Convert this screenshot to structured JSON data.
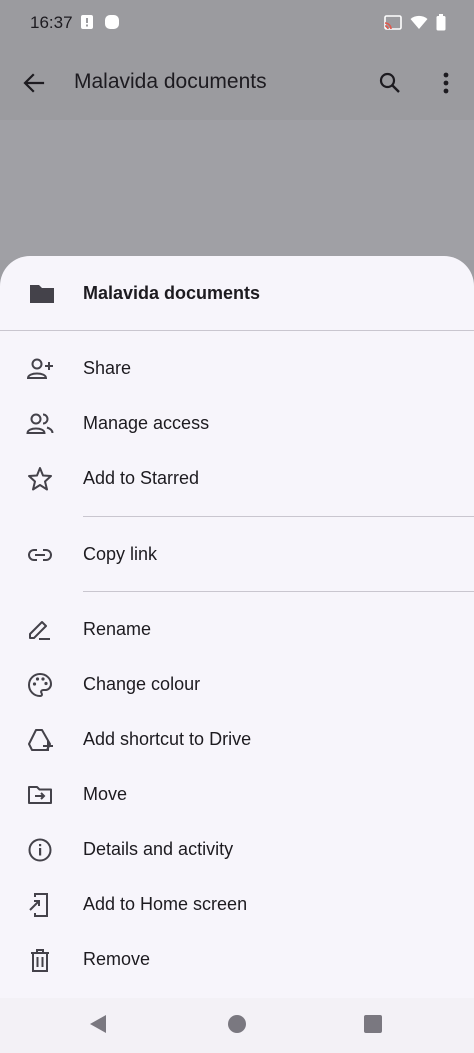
{
  "status_bar": {
    "time": "16:37"
  },
  "app_bar": {
    "title": "Malavida documents"
  },
  "sheet": {
    "title": "Malavida documents",
    "items": [
      {
        "label": "Share",
        "icon": "person-add-icon"
      },
      {
        "label": "Manage access",
        "icon": "people-icon"
      },
      {
        "label": "Add to Starred",
        "icon": "star-outline-icon"
      },
      {
        "label": "Copy link",
        "icon": "link-icon"
      },
      {
        "label": "Rename",
        "icon": "pencil-icon"
      },
      {
        "label": "Change colour",
        "icon": "palette-icon"
      },
      {
        "label": "Add shortcut to Drive",
        "icon": "drive-shortcut-icon"
      },
      {
        "label": "Move",
        "icon": "folder-move-icon"
      },
      {
        "label": "Details and activity",
        "icon": "info-icon"
      },
      {
        "label": "Add to Home screen",
        "icon": "add-to-home-icon"
      },
      {
        "label": "Remove",
        "icon": "trash-icon"
      }
    ]
  },
  "colors": {
    "sheet_bg": "#f7f5fb",
    "scrim": "#9d9da2",
    "text": "#1d1b20",
    "icon": "#44424a"
  }
}
